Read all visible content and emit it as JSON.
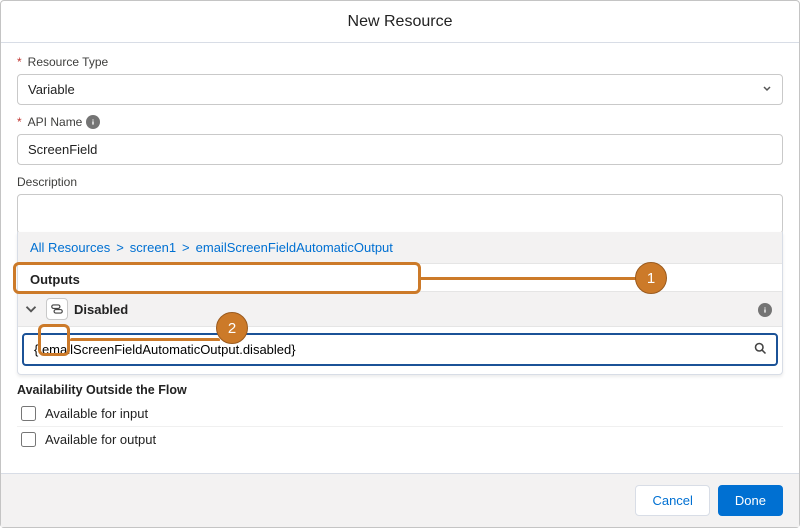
{
  "header": {
    "title": "New Resource"
  },
  "resourceType": {
    "label": "Resource Type",
    "required": true,
    "value": "Variable"
  },
  "apiName": {
    "label": "API Name",
    "required": true,
    "value": "ScreenField"
  },
  "description": {
    "label": "Description",
    "value": ""
  },
  "breadcrumb": {
    "root": "All Resources",
    "level1": "screen1",
    "current": "emailScreenFieldAutomaticOutput",
    "sep": ">"
  },
  "outputs": {
    "header": "Outputs",
    "item": {
      "name": "Disabled",
      "expression": "{!emailScreenFieldAutomaticOutput.disabled}",
      "icon": "toggle-icon"
    }
  },
  "availability": {
    "title": "Availability Outside the Flow",
    "inputLabel": "Available for input",
    "outputLabel": "Available for output",
    "inputChecked": false,
    "outputChecked": false
  },
  "footer": {
    "cancel": "Cancel",
    "done": "Done"
  },
  "callouts": {
    "one": "1",
    "two": "2"
  }
}
